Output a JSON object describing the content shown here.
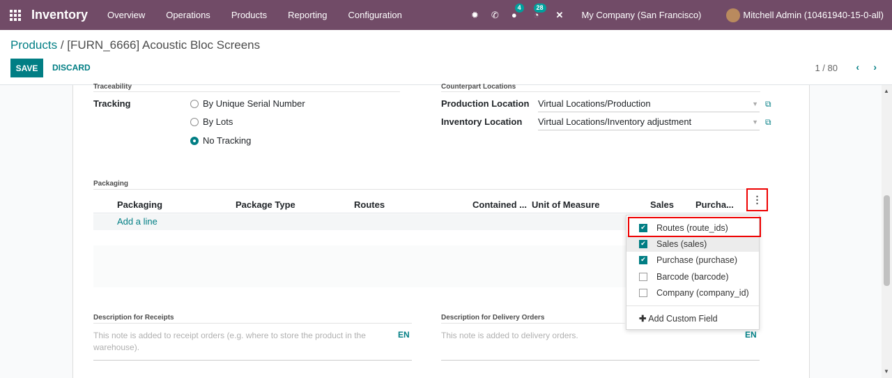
{
  "navbar": {
    "app_name": "Inventory",
    "menu": [
      "Overview",
      "Operations",
      "Products",
      "Reporting",
      "Configuration"
    ],
    "messages_count": "4",
    "activities_count": "28",
    "company": "My Company (San Francisco)",
    "user": "Mitchell Admin (10461940-15-0-all)"
  },
  "control_panel": {
    "breadcrumb_parent": "Products",
    "breadcrumb_separator": " / ",
    "breadcrumb_current": "[FURN_6666] Acoustic Bloc Screens",
    "save_label": "SAVE",
    "discard_label": "DISCARD",
    "pager_value": "1 / 80"
  },
  "form": {
    "traceability_label": "Traceability",
    "tracking_label": "Tracking",
    "tracking_options": [
      {
        "label": "By Unique Serial Number",
        "checked": false
      },
      {
        "label": "By Lots",
        "checked": false
      },
      {
        "label": "No Tracking",
        "checked": true
      }
    ],
    "counterpart_label": "Counterpart Locations",
    "production_location_label": "Production Location",
    "production_location_value": "Virtual Locations/Production",
    "inventory_location_label": "Inventory Location",
    "inventory_location_value": "Virtual Locations/Inventory adjustment",
    "packaging_section_label": "Packaging",
    "desc_receipts_label": "Description for Receipts",
    "desc_receipts_placeholder": "This note is added to receipt orders (e.g. where to store the product in the warehouse).",
    "desc_delivery_label": "Description for Delivery Orders",
    "desc_delivery_placeholder": "This note is added to delivery orders.",
    "lang": "EN"
  },
  "packaging_table": {
    "columns": [
      "Packaging",
      "Package Type",
      "Routes",
      "Contained ...",
      "Unit of Measure",
      "Sales",
      "Purcha..."
    ],
    "add_line": "Add a line"
  },
  "optional_columns": {
    "items": [
      {
        "label": "Routes (route_ids)",
        "checked": true
      },
      {
        "label": "Sales (sales)",
        "checked": true
      },
      {
        "label": "Purchase (purchase)",
        "checked": true
      },
      {
        "label": "Barcode (barcode)",
        "checked": false
      },
      {
        "label": "Company (company_id)",
        "checked": false
      }
    ],
    "add_custom_field": "Add Custom Field"
  },
  "colors": {
    "navbar": "#714B67",
    "accent": "#017e84",
    "highlight": "#e00000"
  }
}
